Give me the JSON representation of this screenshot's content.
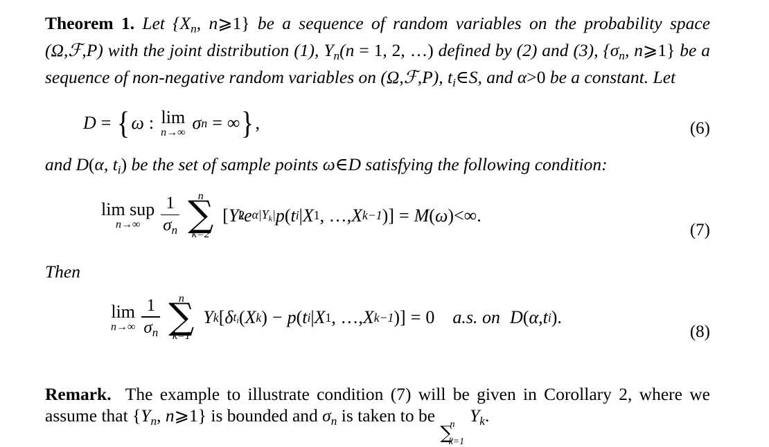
{
  "document": {
    "background_color": "#ffffff",
    "text_color": "#000000"
  },
  "theorem": {
    "label": "Theorem 1.",
    "line1_a": "Let {",
    "line1_X": "X",
    "line1_Xsub": "n",
    "line1_b": ",",
    "line1_n": "n",
    "line1_geq": "⩾",
    "line1_one": "1} ",
    "line1_c": "be a sequence of random variables on the probability",
    "line2_a": "space (",
    "line2_omega": "Ω",
    "line2_comma1": ",",
    "line2_scrF": "ℱ",
    "line2_comma2": ",",
    "line2_P": "P",
    "line2_b": ") with the joint distribution (1), ",
    "line2_Y": "Y",
    "line2_Ysub": "n",
    "line2_c": "(",
    "line2_n": "n",
    "line2_d": " = 1, 2, …) ",
    "line2_e": "defined by (2) and (3),",
    "line3_a": "{",
    "line3_sigma": "σ",
    "line3_sigsub": "n",
    "line3_b": ",",
    "line3_n": "n",
    "line3_geq": "⩾",
    "line3_c": "1} ",
    "line3_d": "be a sequence of non-negative random variables on (",
    "line3_omega": "Ω",
    "line3_scrF": "ℱ",
    "line3_P": "P",
    "line3_e": "), ",
    "line3_t": "t",
    "line3_tsub": "i",
    "line3_in": "∈",
    "line3_S": "S",
    "line3_f": ", and",
    "line4_alpha": "α",
    "line4_gt": ">",
    "line4_zero": "0 ",
    "line4_rest": "be a constant. Let"
  },
  "equation6": {
    "D": "D",
    "eq": "=",
    "brace_open": "{",
    "omega": "ω",
    "colon": ":",
    "lim_main": "lim",
    "lim_sub_n": "n",
    "lim_sub_arrow": "→",
    "lim_sub_inf": "∞",
    "sigma": "σ",
    "sigma_sub": "n",
    "eq2": "=",
    "infinity": "∞",
    "brace_close": "}",
    "comma": ",",
    "number": "(6)"
  },
  "midtext": {
    "a": "and ",
    "D": "D",
    "paren_open": "(",
    "alpha": "α",
    "comma": ", ",
    "t": "t",
    "tsub": "i",
    "paren_close": ")",
    "b": " be the set of sample points ",
    "omega": "ω",
    "in": "∈",
    "D2": "D",
    "c": " satisfying the following condition:"
  },
  "equation7": {
    "limsup": "lim sup",
    "lim_sub_n": "n",
    "lim_sub_arrow": "→",
    "lim_sub_inf": "∞",
    "frac_num": "1",
    "frac_den_sigma": "σ",
    "frac_den_sub": "n",
    "sum_top": "n",
    "sum_glyph": "∑",
    "sum_bot_k": "k",
    "sum_bot_eq": "=",
    "sum_bot_val": "2",
    "bracket_open": "[",
    "Y": "Y",
    "Y_sup": "2",
    "Y_sub": "k",
    "e": "e",
    "e_sup_alpha": "α",
    "e_sup_bar1": "|",
    "e_sup_Y": "Y",
    "e_sup_Ysub": "k",
    "e_sup_bar2": "|",
    "p": "p",
    "p_open": "(",
    "p_t": "t",
    "p_tsub": "i",
    "p_bar": "|",
    "p_X1": "X",
    "p_X1sub": "1",
    "p_dots": ", …, ",
    "p_Xk": "X",
    "p_Xksub": "k−1",
    "p_close": ")",
    "bracket_close": "]",
    "eq": "=",
    "M": "M",
    "M_open": "(",
    "M_omega": "ω",
    "M_close": ")",
    "lt": "<",
    "infinity": "∞",
    "period": ".",
    "number": "(7)"
  },
  "then": {
    "label": "Then"
  },
  "equation8": {
    "lim_main": "lim",
    "lim_sub_n": "n",
    "lim_sub_arrow": "→",
    "lim_sub_inf": "∞",
    "frac_num": "1",
    "frac_den_sigma": "σ",
    "frac_den_sub": "n",
    "sum_top": "n",
    "sum_glyph": "∑",
    "sum_bot_k": "k",
    "sum_bot_eq": "=",
    "sum_bot_val": "1",
    "Y": "Y",
    "Y_sub": "k",
    "bracket_open": "[",
    "delta": "δ",
    "delta_sub_t": "t",
    "delta_sub_i": "i",
    "d_open": "(",
    "d_X": "X",
    "d_Xsub": "k",
    "d_close": ")",
    "minus": "−",
    "p": "p",
    "p_open": "(",
    "p_t": "t",
    "p_tsub": "i",
    "p_bar": "|",
    "p_X1": "X",
    "p_X1sub": "1",
    "p_dots": ", …, ",
    "p_Xk": "X",
    "p_Xksub": "k−1",
    "p_close": ")",
    "bracket_close": "]",
    "eq": "=",
    "zero": "0",
    "as": "a.s. on",
    "D": "D",
    "D_open": "(",
    "D_alpha": "α",
    "D_comma": ", ",
    "D_t": "t",
    "D_tsub": "i",
    "D_close": ")",
    "period": ".",
    "number": "(8)"
  },
  "remark": {
    "label": "Remark.",
    "line1": "The example to illustrate condition (7) will be given in Corollary 2, where",
    "line2_a": "we assume that {",
    "line2_Y": "Y",
    "line2_Ysub": "n",
    "line2_comma": ",",
    "line2_n": "n",
    "line2_geq": "⩾",
    "line2_b": "1} is bounded and ",
    "line2_sigma": "σ",
    "line2_sigsub": "n",
    "line2_c": " is taken to be ",
    "sum_top": "n",
    "sum_glyph": "∑",
    "sum_bot": "k=1",
    "line2_SY": "Y",
    "line2_SYsub": "k",
    "line2_period": "."
  }
}
